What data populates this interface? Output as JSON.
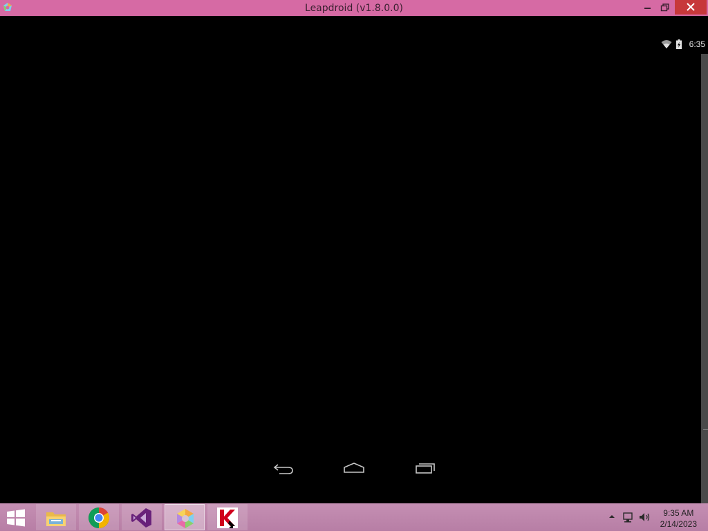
{
  "window": {
    "title": "Leapdroid (v1.8.0.0)"
  },
  "android": {
    "status_time": "6:35",
    "status_icons": [
      "wifi-icon",
      "battery-charging-icon"
    ],
    "nav_buttons": [
      "back-icon",
      "home-icon",
      "recents-icon"
    ]
  },
  "taskbar": {
    "apps": [
      {
        "name": "file-explorer",
        "icon": "folder-icon",
        "state": "running"
      },
      {
        "name": "chrome",
        "icon": "chrome-icon",
        "state": "running"
      },
      {
        "name": "visual-studio",
        "icon": "visual-studio-icon",
        "state": "running"
      },
      {
        "name": "leapdroid",
        "icon": "leapdroid-icon",
        "state": "active"
      },
      {
        "name": "kaspersky",
        "icon": "kaspersky-icon",
        "state": "running"
      }
    ],
    "clock_time": "9:35 AM",
    "clock_date": "2/14/2023"
  },
  "colors": {
    "titlebar": "#d66aa4",
    "close_button": "#c7383a",
    "taskbar": "#c58fb3",
    "android_bg": "#000000"
  }
}
